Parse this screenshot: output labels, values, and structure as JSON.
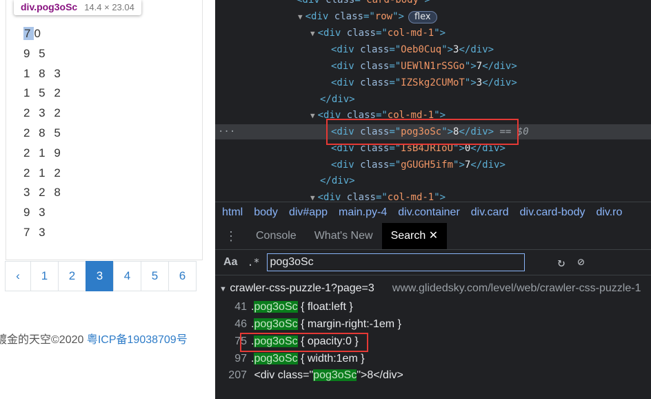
{
  "tooltip": {
    "selector": "div.pog3oSc",
    "size": "14.4 × 23.04"
  },
  "numbers": [
    {
      "rest": "0",
      "first": "7"
    },
    {
      "text": "9 5"
    },
    {
      "text": "1 8 3"
    },
    {
      "text": "1 5 2"
    },
    {
      "text": "2 3 2"
    },
    {
      "text": "2 8 5"
    },
    {
      "text": "2 1 9"
    },
    {
      "text": "2 1 2"
    },
    {
      "text": "3 2 8"
    },
    {
      "text": "9 3"
    },
    {
      "text": "7 3"
    }
  ],
  "pagination": {
    "prev": "‹",
    "pages": [
      "1",
      "2",
      "3",
      "4",
      "5",
      "6"
    ],
    "active": "3"
  },
  "footer": {
    "text": "镀金的天空©2020 ",
    "link": "粤ICP备19038709号"
  },
  "devtools": {
    "lines": [
      {
        "tag": "div",
        "cls": "card-body",
        "partial": true
      },
      {
        "tag": "div",
        "cls": "row",
        "badge": "flex"
      },
      {
        "tag": "div",
        "cls": "col-md-1"
      },
      {
        "tag": "div",
        "cls": "Oeb0Cuq",
        "text": "3"
      },
      {
        "tag": "div",
        "cls": "UEWlN1rSSGo",
        "text": "7"
      },
      {
        "tag": "div",
        "cls": "IZSkg2CUMoT",
        "text": "3"
      },
      {
        "close": "div"
      },
      {
        "tag": "div",
        "cls": "col-md-1"
      },
      {
        "tag": "div",
        "cls": "pog3oSc",
        "text": "8",
        "selected_marker": "== $0"
      },
      {
        "tag": "div",
        "cls": "IsB4JRIoU",
        "text": "0"
      },
      {
        "tag": "div",
        "cls": "gGUGH5ifm",
        "text": "7"
      },
      {
        "close": "div"
      },
      {
        "tag": "div",
        "cls": "col-md-1"
      }
    ],
    "breadcrumbs": [
      "html",
      "body",
      "div#app",
      "main.py-4",
      "div.container",
      "div.card",
      "div.card-body",
      "div.ro"
    ],
    "drawer_tabs": [
      "Console",
      "What's New",
      "Search"
    ],
    "active_tab": "Search",
    "search": {
      "aa": "Aa",
      "regex": ".*",
      "value": "pog3oSc"
    },
    "results_file": {
      "name": "crawler-css-puzzle-1?page=3",
      "url": "www.glidedsky.com/level/web/crawler-css-puzzle-1"
    },
    "results": [
      {
        "line": "41",
        "pre": ".",
        "match": "pog3oSc",
        "post": " { float:left }"
      },
      {
        "line": "46",
        "pre": ".",
        "match": "pog3oSc",
        "post": " { margin-right:-1em }"
      },
      {
        "line": "75",
        "pre": ".",
        "match": "pog3oSc",
        "post": " { opacity:0 }"
      },
      {
        "line": "97",
        "pre": ".",
        "match": "pog3oSc",
        "post": " { width:1em }"
      },
      {
        "line": "207",
        "pre": "<div class=\"",
        "match": "pog3oSc",
        "post": "\">8</div>"
      }
    ]
  }
}
